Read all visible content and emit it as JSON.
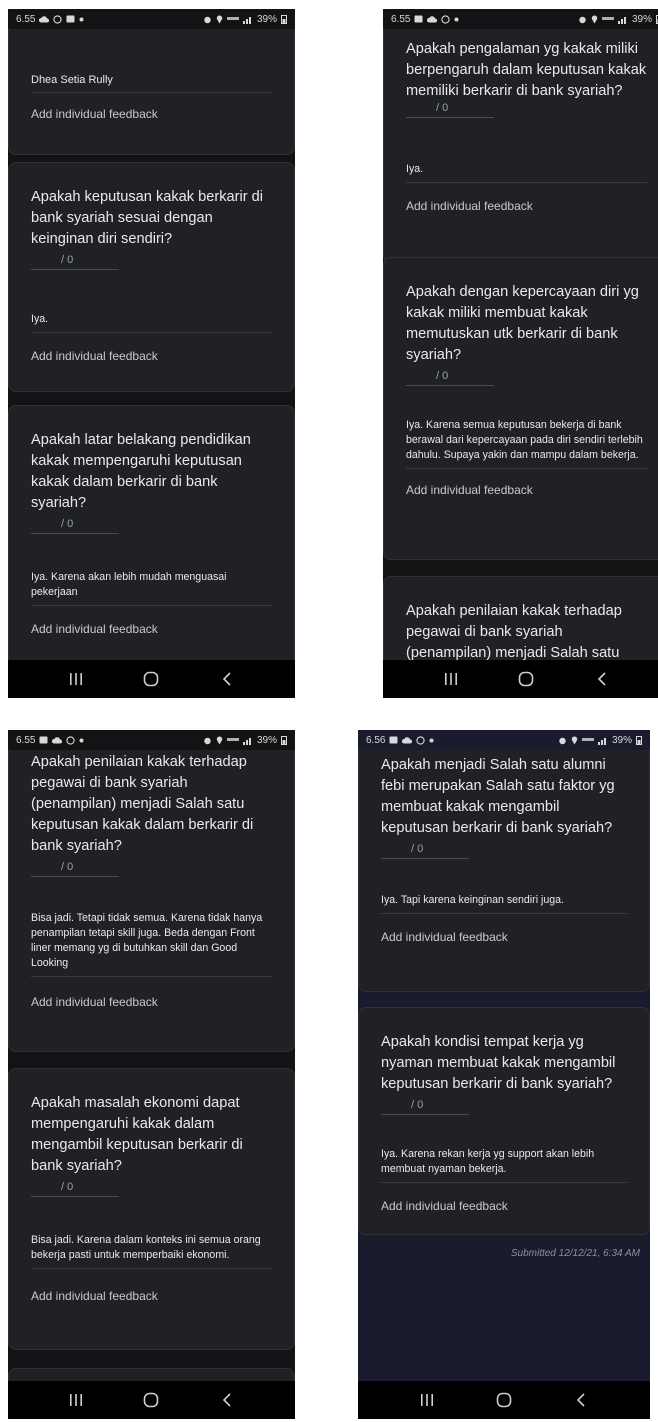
{
  "screens": [
    {
      "status": {
        "time": "6.55",
        "battery": "39%"
      },
      "name": "Dhea Setia Rully",
      "feedback_label": "Add individual feedback",
      "cards": [
        {
          "question": "Apakah keputusan kakak berkarir di bank syariah sesuai dengan keinginan diri sendiri?",
          "score": "/ 0",
          "answer": "Iya.",
          "feedback": "Add individual feedback"
        },
        {
          "question": "Apakah latar belakang pendidikan kakak mempengaruhi keputusan kakak dalam berkarir di bank syariah?",
          "score": "/ 0",
          "answer": "Iya. Karena akan lebih mudah menguasai pekerjaan",
          "feedback": "Add individual feedback"
        }
      ]
    },
    {
      "status": {
        "time": "6.55",
        "battery": "39%"
      },
      "cards": [
        {
          "question": "Apakah pengalaman yg kakak miliki berpengaruh dalam keputusan kakak memiliki berkarir di bank syariah?",
          "score": "/ 0",
          "answer": "Iya.",
          "feedback": "Add individual feedback"
        },
        {
          "question": "Apakah dengan kepercayaan diri yg kakak miliki membuat kakak memutuskan utk berkarir di bank syariah?",
          "score": "/ 0",
          "answer": "Iya. Karena semua keputusan bekerja di bank berawal dari kepercayaan pada diri sendiri terlebih dahulu. Supaya yakin dan mampu dalam bekerja.",
          "feedback": "Add individual feedback"
        },
        {
          "question": "Apakah penilaian kakak terhadap pegawai di bank syariah (penampilan) menjadi Salah satu"
        }
      ]
    },
    {
      "status": {
        "time": "6.55",
        "battery": "39%"
      },
      "cards": [
        {
          "question": "Apakah penilaian kakak terhadap pegawai di bank syariah (penampilan) menjadi Salah satu keputusan kakak dalam berkarir di bank syariah?",
          "score": "/ 0",
          "answer": "Bisa jadi. Tetapi tidak semua. Karena tidak hanya penampilan tetapi skill juga. Beda dengan Front liner memang yg di butuhkan skill dan Good Looking",
          "feedback": "Add individual feedback"
        },
        {
          "question": "Apakah masalah ekonomi dapat mempengaruhi kakak dalam mengambil keputusan berkarir di bank syariah?",
          "score": "/ 0",
          "answer": "Bisa jadi. Karena dalam konteks ini semua orang bekerja pasti untuk memperbaiki ekonomi.",
          "feedback": "Add individual feedback"
        }
      ]
    },
    {
      "status": {
        "time": "6.56",
        "battery": "39%"
      },
      "cards": [
        {
          "question": "Apakah menjadi Salah satu alumni febi merupakan Salah satu faktor yg membuat kakak mengambil keputusan berkarir di bank syariah?",
          "score": "/ 0",
          "answer": "Iya. Tapi karena keinginan sendiri juga.",
          "feedback": "Add individual feedback"
        },
        {
          "question": "Apakah kondisi tempat kerja yg nyaman membuat kakak mengambil keputusan berkarir di bank syariah?",
          "score": "/ 0",
          "answer": "Iya. Karena rekan kerja yg support akan lebih membuat nyaman bekerja.",
          "feedback": "Add individual feedback"
        }
      ],
      "submitted": "Submitted 12/12/21, 6:34 AM"
    }
  ],
  "icons": {
    "status_left": [
      "cloud-icon",
      "whatsapp-icon",
      "gallery-icon",
      "dot-icon"
    ],
    "status_right": [
      "alarm-icon",
      "location-icon",
      "lte-icon",
      "signal-icon",
      "battery-icon"
    ],
    "nav": [
      "recent-apps-icon",
      "home-icon",
      "back-icon"
    ]
  }
}
